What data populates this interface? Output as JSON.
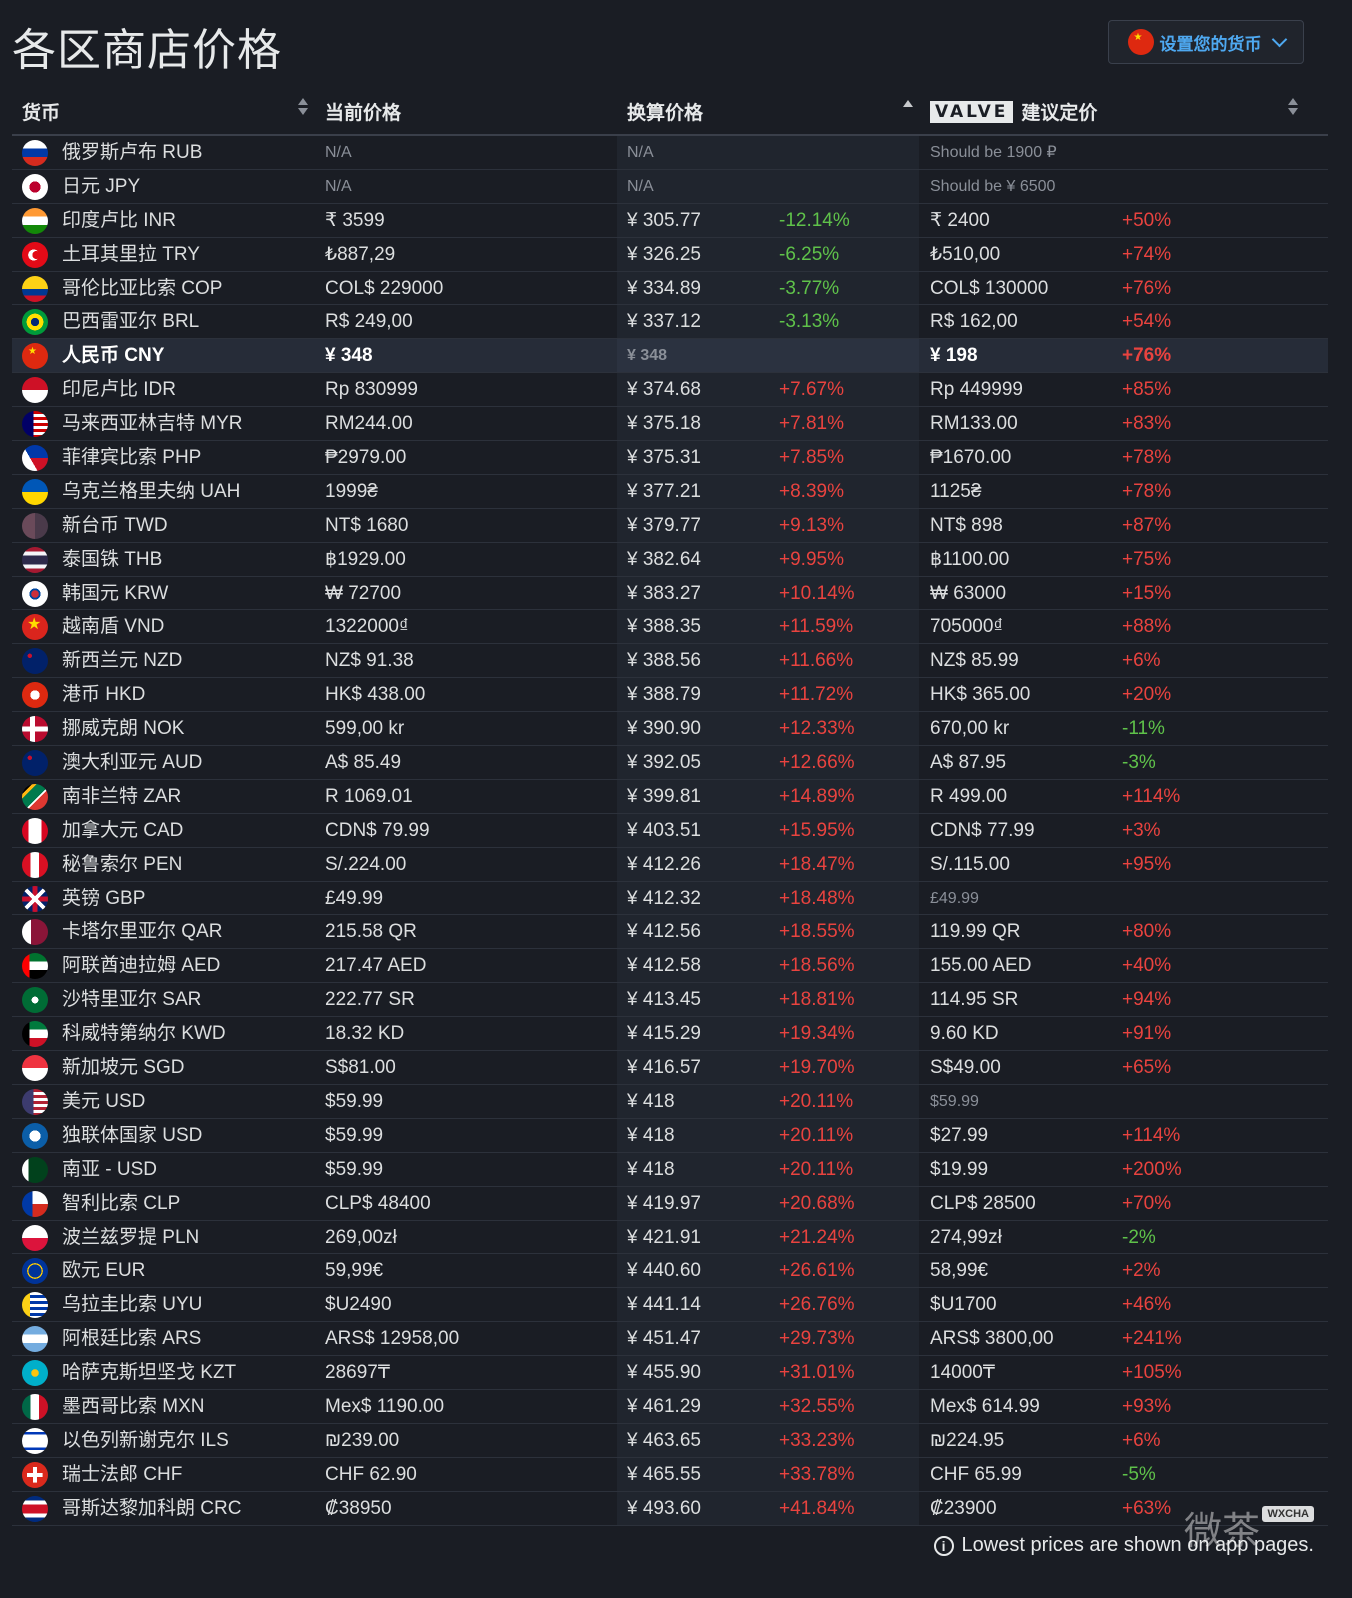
{
  "page": {
    "title": "各区商店价格"
  },
  "currency_button": {
    "label": "设置您的货币"
  },
  "header": {
    "currency": "货币",
    "current_price": "当前价格",
    "converted_price": "换算价格",
    "valve_logo": "VALVE",
    "valve_suggested": "建议定价"
  },
  "colors": {
    "positive": "#e9433f",
    "negative": "#5fc24a",
    "accent": "#4ea8f0"
  },
  "rows": [
    {
      "flag": "ru",
      "name": "俄罗斯卢布 RUB",
      "price": "N/A",
      "converted": "N/A",
      "diff": "",
      "valve": "Should be 1900 ₽",
      "valve_diff": "",
      "muted": true
    },
    {
      "flag": "jp",
      "name": "日元 JPY",
      "price": "N/A",
      "converted": "N/A",
      "diff": "",
      "valve": "Should be ¥ 6500",
      "valve_diff": "",
      "muted": true
    },
    {
      "flag": "in",
      "name": "印度卢比 INR",
      "price": "₹ 3599",
      "converted": "¥ 305.77",
      "diff": "-12.14%",
      "valve": "₹ 2400",
      "valve_diff": "+50%"
    },
    {
      "flag": "tr",
      "name": "土耳其里拉 TRY",
      "price": "₺887,29",
      "converted": "¥ 326.25",
      "diff": "-6.25%",
      "valve": "₺510,00",
      "valve_diff": "+74%"
    },
    {
      "flag": "co",
      "name": "哥伦比亚比索 COP",
      "price": "COL$ 229000",
      "converted": "¥ 334.89",
      "diff": "-3.77%",
      "valve": "COL$ 130000",
      "valve_diff": "+76%"
    },
    {
      "flag": "br",
      "name": "巴西雷亚尔 BRL",
      "price": "R$ 249,00",
      "converted": "¥ 337.12",
      "diff": "-3.13%",
      "valve": "R$ 162,00",
      "valve_diff": "+54%"
    },
    {
      "flag": "cn",
      "name": "人民币 CNY",
      "price": "¥ 348",
      "converted": "¥ 348",
      "diff": "",
      "valve": "¥ 198",
      "valve_diff": "+76%",
      "highlight": true
    },
    {
      "flag": "id",
      "name": "印尼卢比 IDR",
      "price": "Rp 830999",
      "converted": "¥ 374.68",
      "diff": "+7.67%",
      "valve": "Rp 449999",
      "valve_diff": "+85%"
    },
    {
      "flag": "my",
      "name": "马来西亚林吉特 MYR",
      "price": "RM244.00",
      "converted": "¥ 375.18",
      "diff": "+7.81%",
      "valve": "RM133.00",
      "valve_diff": "+83%"
    },
    {
      "flag": "ph",
      "name": "菲律宾比索 PHP",
      "price": "₱2979.00",
      "converted": "¥ 375.31",
      "diff": "+7.85%",
      "valve": "₱1670.00",
      "valve_diff": "+78%"
    },
    {
      "flag": "ua",
      "name": "乌克兰格里夫纳 UAH",
      "price": "1999₴",
      "converted": "¥ 377.21",
      "diff": "+8.39%",
      "valve": "1125₴",
      "valve_diff": "+78%"
    },
    {
      "flag": "tw",
      "name": "新台币 TWD",
      "price": "NT$ 1680",
      "converted": "¥ 379.77",
      "diff": "+9.13%",
      "valve": "NT$ 898",
      "valve_diff": "+87%"
    },
    {
      "flag": "th",
      "name": "泰国铢 THB",
      "price": "฿1929.00",
      "converted": "¥ 382.64",
      "diff": "+9.95%",
      "valve": "฿1100.00",
      "valve_diff": "+75%"
    },
    {
      "flag": "kr",
      "name": "韩国元 KRW",
      "price": "₩ 72700",
      "converted": "¥ 383.27",
      "diff": "+10.14%",
      "valve": "₩ 63000",
      "valve_diff": "+15%"
    },
    {
      "flag": "vn",
      "name": "越南盾 VND",
      "price": "1322000₫",
      "converted": "¥ 388.35",
      "diff": "+11.59%",
      "valve": "705000₫",
      "valve_diff": "+88%"
    },
    {
      "flag": "nz",
      "name": "新西兰元 NZD",
      "price": "NZ$ 91.38",
      "converted": "¥ 388.56",
      "diff": "+11.66%",
      "valve": "NZ$ 85.99",
      "valve_diff": "+6%"
    },
    {
      "flag": "hk",
      "name": "港币 HKD",
      "price": "HK$ 438.00",
      "converted": "¥ 388.79",
      "diff": "+11.72%",
      "valve": "HK$ 365.00",
      "valve_diff": "+20%"
    },
    {
      "flag": "no",
      "name": "挪威克朗 NOK",
      "price": "599,00 kr",
      "converted": "¥ 390.90",
      "diff": "+12.33%",
      "valve": "670,00 kr",
      "valve_diff": "-11%"
    },
    {
      "flag": "au",
      "name": "澳大利亚元 AUD",
      "price": "A$ 85.49",
      "converted": "¥ 392.05",
      "diff": "+12.66%",
      "valve": "A$ 87.95",
      "valve_diff": "-3%"
    },
    {
      "flag": "za",
      "name": "南非兰特 ZAR",
      "price": "R 1069.01",
      "converted": "¥ 399.81",
      "diff": "+14.89%",
      "valve": "R 499.00",
      "valve_diff": "+114%"
    },
    {
      "flag": "ca",
      "name": "加拿大元 CAD",
      "price": "CDN$ 79.99",
      "converted": "¥ 403.51",
      "diff": "+15.95%",
      "valve": "CDN$ 77.99",
      "valve_diff": "+3%"
    },
    {
      "flag": "pe",
      "name": "秘鲁索尔 PEN",
      "price": "S/.224.00",
      "converted": "¥ 412.26",
      "diff": "+18.47%",
      "valve": "S/.115.00",
      "valve_diff": "+95%"
    },
    {
      "flag": "gb",
      "name": "英镑 GBP",
      "price": "£49.99",
      "converted": "¥ 412.32",
      "diff": "+18.48%",
      "valve": "£49.99",
      "valve_diff": "",
      "valve_muted": true
    },
    {
      "flag": "qa",
      "name": "卡塔尔里亚尔 QAR",
      "price": "215.58 QR",
      "converted": "¥ 412.56",
      "diff": "+18.55%",
      "valve": "119.99 QR",
      "valve_diff": "+80%"
    },
    {
      "flag": "ae",
      "name": "阿联酋迪拉姆 AED",
      "price": "217.47 AED",
      "converted": "¥ 412.58",
      "diff": "+18.56%",
      "valve": "155.00 AED",
      "valve_diff": "+40%"
    },
    {
      "flag": "sa",
      "name": "沙特里亚尔 SAR",
      "price": "222.77 SR",
      "converted": "¥ 413.45",
      "diff": "+18.81%",
      "valve": "114.95 SR",
      "valve_diff": "+94%"
    },
    {
      "flag": "kw",
      "name": "科威特第纳尔 KWD",
      "price": "18.32 KD",
      "converted": "¥ 415.29",
      "diff": "+19.34%",
      "valve": "9.60 KD",
      "valve_diff": "+91%"
    },
    {
      "flag": "sg",
      "name": "新加坡元 SGD",
      "price": "S$81.00",
      "converted": "¥ 416.57",
      "diff": "+19.70%",
      "valve": "S$49.00",
      "valve_diff": "+65%"
    },
    {
      "flag": "us",
      "name": "美元 USD",
      "price": "$59.99",
      "converted": "¥ 418",
      "diff": "+20.11%",
      "valve": "$59.99",
      "valve_diff": "",
      "valve_muted": true
    },
    {
      "flag": "cis",
      "name": "独联体国家 USD",
      "price": "$59.99",
      "converted": "¥ 418",
      "diff": "+20.11%",
      "valve": "$27.99",
      "valve_diff": "+114%"
    },
    {
      "flag": "pk",
      "name": "南亚 - USD",
      "price": "$59.99",
      "converted": "¥ 418",
      "diff": "+20.11%",
      "valve": "$19.99",
      "valve_diff": "+200%"
    },
    {
      "flag": "cl",
      "name": "智利比索 CLP",
      "price": "CLP$ 48400",
      "converted": "¥ 419.97",
      "diff": "+20.68%",
      "valve": "CLP$ 28500",
      "valve_diff": "+70%"
    },
    {
      "flag": "pl",
      "name": "波兰兹罗提 PLN",
      "price": "269,00zł",
      "converted": "¥ 421.91",
      "diff": "+21.24%",
      "valve": "274,99zł",
      "valve_diff": "-2%"
    },
    {
      "flag": "eu",
      "name": "欧元 EUR",
      "price": "59,99€",
      "converted": "¥ 440.60",
      "diff": "+26.61%",
      "valve": "58,99€",
      "valve_diff": "+2%"
    },
    {
      "flag": "uy",
      "name": "乌拉圭比索 UYU",
      "price": "$U2490",
      "converted": "¥ 441.14",
      "diff": "+26.76%",
      "valve": "$U1700",
      "valve_diff": "+46%"
    },
    {
      "flag": "ar",
      "name": "阿根廷比索 ARS",
      "price": "ARS$ 12958,00",
      "converted": "¥ 451.47",
      "diff": "+29.73%",
      "valve": "ARS$ 3800,00",
      "valve_diff": "+241%"
    },
    {
      "flag": "kz",
      "name": "哈萨克斯坦坚戈 KZT",
      "price": "28697₸",
      "converted": "¥ 455.90",
      "diff": "+31.01%",
      "valve": "14000₸",
      "valve_diff": "+105%"
    },
    {
      "flag": "mx",
      "name": "墨西哥比索 MXN",
      "price": "Mex$ 1190.00",
      "converted": "¥ 461.29",
      "diff": "+32.55%",
      "valve": "Mex$ 614.99",
      "valve_diff": "+93%"
    },
    {
      "flag": "il",
      "name": "以色列新谢克尔 ILS",
      "price": "₪239.00",
      "converted": "¥ 463.65",
      "diff": "+33.23%",
      "valve": "₪224.95",
      "valve_diff": "+6%"
    },
    {
      "flag": "ch",
      "name": "瑞士法郎 CHF",
      "price": "CHF 62.90",
      "converted": "¥ 465.55",
      "diff": "+33.78%",
      "valve": "CHF 65.99",
      "valve_diff": "-5%"
    },
    {
      "flag": "cr",
      "name": "哥斯达黎加科朗 CRC",
      "price": "₡38950",
      "converted": "¥ 493.60",
      "diff": "+41.84%",
      "valve": "₡23900",
      "valve_diff": "+63%"
    }
  ],
  "footer": {
    "note": "Lowest prices are shown on app pages."
  },
  "watermark": {
    "text": "微茶",
    "box": "WXCHA"
  }
}
